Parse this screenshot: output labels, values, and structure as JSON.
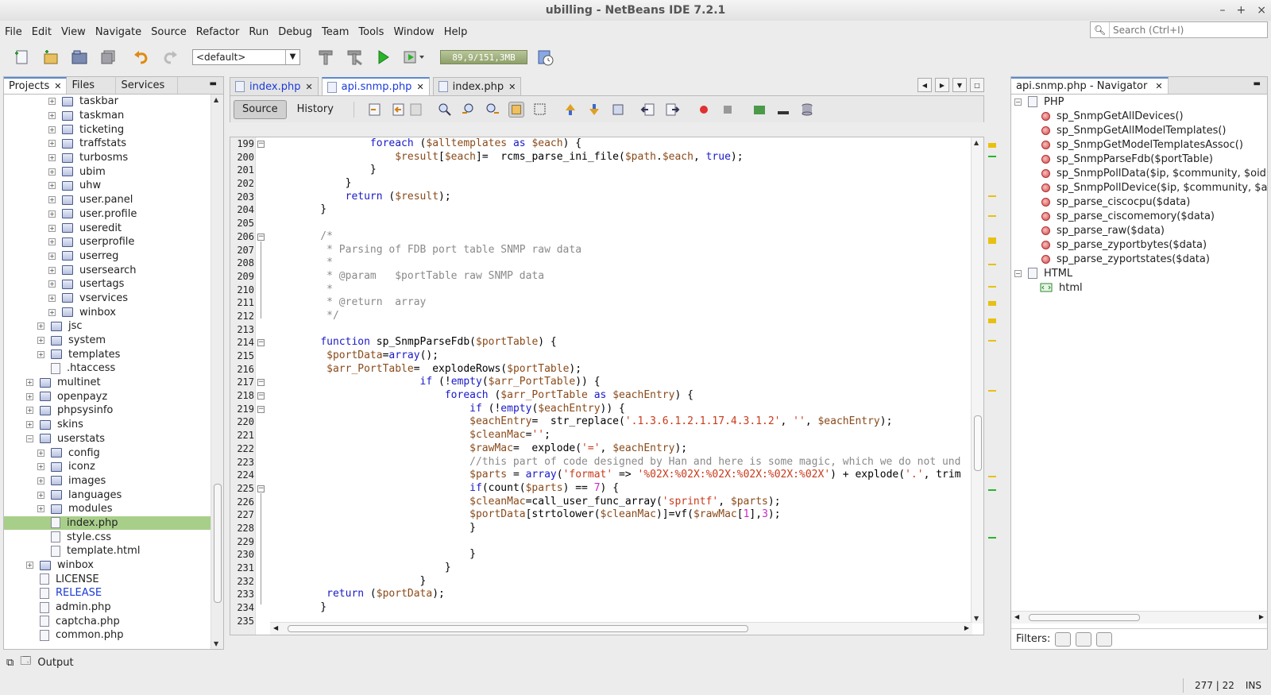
{
  "window": {
    "title": "ubilling - NetBeans IDE 7.2.1",
    "controls": [
      "–",
      "+",
      "×"
    ]
  },
  "menu": [
    "File",
    "Edit",
    "View",
    "Navigate",
    "Source",
    "Refactor",
    "Run",
    "Debug",
    "Team",
    "Tools",
    "Window",
    "Help"
  ],
  "search": {
    "placeholder": "Search (Ctrl+I)"
  },
  "toolbar": {
    "config": "<default>",
    "memory": "89,9/151,3MB"
  },
  "projects_panel": {
    "tabs": [
      {
        "label": "Projects",
        "active": true
      },
      {
        "label": "Files"
      },
      {
        "label": "Services"
      }
    ],
    "tree": [
      {
        "label": "taskbar",
        "indent": 3,
        "exp": "+",
        "icon": "folder"
      },
      {
        "label": "taskman",
        "indent": 3,
        "exp": "+",
        "icon": "folder"
      },
      {
        "label": "ticketing",
        "indent": 3,
        "exp": "+",
        "icon": "folder"
      },
      {
        "label": "traffstats",
        "indent": 3,
        "exp": "+",
        "icon": "folder"
      },
      {
        "label": "turbosms",
        "indent": 3,
        "exp": "+",
        "icon": "folder"
      },
      {
        "label": "ubim",
        "indent": 3,
        "exp": "+",
        "icon": "folder"
      },
      {
        "label": "uhw",
        "indent": 3,
        "exp": "+",
        "icon": "folder"
      },
      {
        "label": "user.panel",
        "indent": 3,
        "exp": "+",
        "icon": "folder"
      },
      {
        "label": "user.profile",
        "indent": 3,
        "exp": "+",
        "icon": "folder"
      },
      {
        "label": "useredit",
        "indent": 3,
        "exp": "+",
        "icon": "folder"
      },
      {
        "label": "userprofile",
        "indent": 3,
        "exp": "+",
        "icon": "folder"
      },
      {
        "label": "userreg",
        "indent": 3,
        "exp": "+",
        "icon": "folder"
      },
      {
        "label": "usersearch",
        "indent": 3,
        "exp": "+",
        "icon": "folder"
      },
      {
        "label": "usertags",
        "indent": 3,
        "exp": "+",
        "icon": "folder"
      },
      {
        "label": "vservices",
        "indent": 3,
        "exp": "+",
        "icon": "folder"
      },
      {
        "label": "winbox",
        "indent": 3,
        "exp": "+",
        "icon": "folder"
      },
      {
        "label": "jsc",
        "indent": 2,
        "exp": "+",
        "icon": "folder"
      },
      {
        "label": "system",
        "indent": 2,
        "exp": "+",
        "icon": "folder"
      },
      {
        "label": "templates",
        "indent": 2,
        "exp": "+",
        "icon": "folder"
      },
      {
        "label": ".htaccess",
        "indent": 2,
        "exp": "",
        "icon": "file"
      },
      {
        "label": "multinet",
        "indent": 1,
        "exp": "+",
        "icon": "folder"
      },
      {
        "label": "openpayz",
        "indent": 1,
        "exp": "+",
        "icon": "folder"
      },
      {
        "label": "phpsysinfo",
        "indent": 1,
        "exp": "+",
        "icon": "folder"
      },
      {
        "label": "skins",
        "indent": 1,
        "exp": "+",
        "icon": "folder"
      },
      {
        "label": "userstats",
        "indent": 1,
        "exp": "−",
        "icon": "folder"
      },
      {
        "label": "config",
        "indent": 2,
        "exp": "+",
        "icon": "folder"
      },
      {
        "label": "iconz",
        "indent": 2,
        "exp": "+",
        "icon": "folder"
      },
      {
        "label": "images",
        "indent": 2,
        "exp": "+",
        "icon": "folder"
      },
      {
        "label": "languages",
        "indent": 2,
        "exp": "+",
        "icon": "folder"
      },
      {
        "label": "modules",
        "indent": 2,
        "exp": "+",
        "icon": "folder"
      },
      {
        "label": "index.php",
        "indent": 2,
        "exp": "",
        "icon": "file",
        "selected": true
      },
      {
        "label": "style.css",
        "indent": 2,
        "exp": "",
        "icon": "file"
      },
      {
        "label": "template.html",
        "indent": 2,
        "exp": "",
        "icon": "file"
      },
      {
        "label": "winbox",
        "indent": 1,
        "exp": "+",
        "icon": "folder"
      },
      {
        "label": "LICENSE",
        "indent": 1,
        "exp": "",
        "icon": "file"
      },
      {
        "label": "RELEASE",
        "indent": 1,
        "exp": "",
        "icon": "file",
        "blue": true
      },
      {
        "label": "admin.php",
        "indent": 1,
        "exp": "",
        "icon": "file"
      },
      {
        "label": "captcha.php",
        "indent": 1,
        "exp": "",
        "icon": "file"
      },
      {
        "label": "common.php",
        "indent": 1,
        "exp": "",
        "icon": "file"
      }
    ]
  },
  "editor": {
    "tabs": [
      {
        "label": "index.php"
      },
      {
        "label": "api.snmp.php",
        "active": true
      },
      {
        "label": "index.php"
      }
    ],
    "source_label": "Source",
    "history_label": "History",
    "lines": [
      {
        "n": "199",
        "t": [
          [
            "            ",
            ""
          ],
          [
            "foreach",
            "kw"
          ],
          [
            " (",
            ""
          ],
          [
            "$alltemplates",
            "var"
          ],
          [
            " ",
            ""
          ],
          [
            "as",
            "kw"
          ],
          [
            " ",
            ""
          ],
          [
            "$each",
            "var"
          ],
          [
            ") {",
            ""
          ]
        ]
      },
      {
        "n": "200",
        "t": [
          [
            "                ",
            ""
          ],
          [
            "$result",
            "var"
          ],
          [
            "[",
            ""
          ],
          [
            "$each",
            "var"
          ],
          [
            "]=  rcms_parse_ini_file(",
            ""
          ],
          [
            "$path",
            "var"
          ],
          [
            ".",
            ""
          ],
          [
            "$each",
            "var"
          ],
          [
            ", ",
            ""
          ],
          [
            "true",
            "kw"
          ],
          [
            ");",
            ""
          ]
        ]
      },
      {
        "n": "201",
        "t": [
          [
            "            }",
            ""
          ]
        ]
      },
      {
        "n": "202",
        "t": [
          [
            "        }",
            ""
          ]
        ]
      },
      {
        "n": "203",
        "t": [
          [
            "        ",
            ""
          ],
          [
            "return",
            "kw"
          ],
          [
            " (",
            ""
          ],
          [
            "$result",
            "var"
          ],
          [
            ");",
            ""
          ]
        ]
      },
      {
        "n": "204",
        "t": [
          [
            "    }",
            ""
          ]
        ]
      },
      {
        "n": "205",
        "t": [
          [
            "",
            ""
          ]
        ]
      },
      {
        "n": "206",
        "t": [
          [
            "    /*",
            "cmt"
          ]
        ]
      },
      {
        "n": "207",
        "t": [
          [
            "     * Parsing of FDB port table SNMP raw data",
            "cmt"
          ]
        ]
      },
      {
        "n": "208",
        "t": [
          [
            "     *",
            "cmt"
          ]
        ]
      },
      {
        "n": "209",
        "t": [
          [
            "     * @param   $portTable raw SNMP data",
            "cmt"
          ]
        ]
      },
      {
        "n": "210",
        "t": [
          [
            "     *",
            "cmt"
          ]
        ]
      },
      {
        "n": "211",
        "t": [
          [
            "     * @return  array",
            "cmt"
          ]
        ]
      },
      {
        "n": "212",
        "t": [
          [
            "     */",
            "cmt"
          ]
        ]
      },
      {
        "n": "213",
        "t": [
          [
            "",
            ""
          ]
        ]
      },
      {
        "n": "214",
        "t": [
          [
            "    ",
            ""
          ],
          [
            "function",
            "kw"
          ],
          [
            " sp_SnmpParseFdb(",
            ""
          ],
          [
            "$portTable",
            "var"
          ],
          [
            ") {",
            ""
          ]
        ]
      },
      {
        "n": "215",
        "t": [
          [
            "     ",
            ""
          ],
          [
            "$portData",
            "var"
          ],
          [
            "=",
            ""
          ],
          [
            "array",
            "kw"
          ],
          [
            "();",
            ""
          ]
        ]
      },
      {
        "n": "216",
        "t": [
          [
            "     ",
            ""
          ],
          [
            "$arr_PortTable",
            "var"
          ],
          [
            "=  explodeRows(",
            ""
          ],
          [
            "$portTable",
            "var"
          ],
          [
            ");",
            ""
          ]
        ]
      },
      {
        "n": "217",
        "t": [
          [
            "                    ",
            ""
          ],
          [
            "if",
            "kw"
          ],
          [
            " (!",
            ""
          ],
          [
            "empty",
            "kw"
          ],
          [
            "(",
            ""
          ],
          [
            "$arr_PortTable",
            "var"
          ],
          [
            ")) {",
            ""
          ]
        ]
      },
      {
        "n": "218",
        "t": [
          [
            "                        ",
            ""
          ],
          [
            "foreach",
            "kw"
          ],
          [
            " (",
            ""
          ],
          [
            "$arr_PortTable",
            "var"
          ],
          [
            " ",
            ""
          ],
          [
            "as",
            "kw"
          ],
          [
            " ",
            ""
          ],
          [
            "$eachEntry",
            "var"
          ],
          [
            ") {",
            ""
          ]
        ]
      },
      {
        "n": "219",
        "t": [
          [
            "                            ",
            ""
          ],
          [
            "if",
            "kw"
          ],
          [
            " (!",
            ""
          ],
          [
            "empty",
            "kw"
          ],
          [
            "(",
            ""
          ],
          [
            "$eachEntry",
            "var"
          ],
          [
            ")) {",
            ""
          ]
        ]
      },
      {
        "n": "220",
        "t": [
          [
            "                            ",
            ""
          ],
          [
            "$eachEntry",
            "var"
          ],
          [
            "=  str_replace(",
            ""
          ],
          [
            "'.1.3.6.1.2.1.17.4.3.1.2'",
            "str"
          ],
          [
            ", ",
            ""
          ],
          [
            "''",
            "str"
          ],
          [
            ", ",
            ""
          ],
          [
            "$eachEntry",
            "var"
          ],
          [
            ");",
            ""
          ]
        ]
      },
      {
        "n": "221",
        "t": [
          [
            "                            ",
            ""
          ],
          [
            "$cleanMac",
            "var"
          ],
          [
            "=",
            ""
          ],
          [
            "''",
            "str"
          ],
          [
            ";",
            ""
          ]
        ]
      },
      {
        "n": "222",
        "t": [
          [
            "                            ",
            ""
          ],
          [
            "$rawMac",
            "var"
          ],
          [
            "=  explode(",
            ""
          ],
          [
            "'='",
            "str"
          ],
          [
            ", ",
            ""
          ],
          [
            "$eachEntry",
            "var"
          ],
          [
            ");",
            ""
          ]
        ]
      },
      {
        "n": "223",
        "t": [
          [
            "                            //this part of code designed by Han and here is some magic, which we do not und",
            "cmt"
          ]
        ]
      },
      {
        "n": "224",
        "t": [
          [
            "                            ",
            ""
          ],
          [
            "$parts",
            "var"
          ],
          [
            " = ",
            ""
          ],
          [
            "array",
            "kw"
          ],
          [
            "(",
            ""
          ],
          [
            "'format'",
            "str"
          ],
          [
            " => ",
            ""
          ],
          [
            "'%02X:%02X:%02X:%02X:%02X:%02X'",
            "str"
          ],
          [
            ") + explode(",
            ""
          ],
          [
            "'.'",
            "str"
          ],
          [
            ", trim",
            ""
          ]
        ]
      },
      {
        "n": "225",
        "t": [
          [
            "                            ",
            ""
          ],
          [
            "if",
            "kw"
          ],
          [
            "(count(",
            ""
          ],
          [
            "$parts",
            "var"
          ],
          [
            ") == ",
            ""
          ],
          [
            "7",
            "num"
          ],
          [
            ") {",
            ""
          ]
        ]
      },
      {
        "n": "226",
        "t": [
          [
            "                            ",
            ""
          ],
          [
            "$cleanMac",
            "var"
          ],
          [
            "=call_user_func_array(",
            ""
          ],
          [
            "'sprintf'",
            "str"
          ],
          [
            ", ",
            ""
          ],
          [
            "$parts",
            "var"
          ],
          [
            ");",
            ""
          ]
        ]
      },
      {
        "n": "227",
        "t": [
          [
            "                            ",
            ""
          ],
          [
            "$portData",
            "var"
          ],
          [
            "[strtolower(",
            ""
          ],
          [
            "$cleanMac",
            "var"
          ],
          [
            ")]=vf(",
            ""
          ],
          [
            "$rawMac",
            "var"
          ],
          [
            "[",
            ""
          ],
          [
            "1",
            "num"
          ],
          [
            "],",
            ""
          ],
          [
            "3",
            "num"
          ],
          [
            ");",
            ""
          ]
        ]
      },
      {
        "n": "228",
        "t": [
          [
            "                            }",
            ""
          ]
        ]
      },
      {
        "n": "229",
        "t": [
          [
            "",
            ""
          ]
        ]
      },
      {
        "n": "230",
        "t": [
          [
            "                            }",
            ""
          ]
        ]
      },
      {
        "n": "231",
        "t": [
          [
            "                        }",
            ""
          ]
        ]
      },
      {
        "n": "232",
        "t": [
          [
            "                    }",
            ""
          ]
        ]
      },
      {
        "n": "233",
        "t": [
          [
            "     ",
            ""
          ],
          [
            "return",
            "kw"
          ],
          [
            " (",
            ""
          ],
          [
            "$portData",
            "var"
          ],
          [
            ");",
            ""
          ]
        ]
      },
      {
        "n": "234",
        "t": [
          [
            "    }",
            ""
          ]
        ]
      },
      {
        "n": "235",
        "t": [
          [
            "",
            ""
          ]
        ]
      }
    ]
  },
  "navigator": {
    "tab": "api.snmp.php - Navigator",
    "php_label": "PHP",
    "functions": [
      "sp_SnmpGetAllDevices()",
      "sp_SnmpGetAllModelTemplates()",
      "sp_SnmpGetModelTemplatesAssoc()",
      "sp_SnmpParseFdb($portTable)",
      "sp_SnmpPollData($ip, $community, $oid, $c",
      "sp_SnmpPollDevice($ip, $community, $allte",
      "sp_parse_ciscocpu($data)",
      "sp_parse_ciscomemory($data)",
      "sp_parse_raw($data)",
      "sp_parse_zyportbytes($data)",
      "sp_parse_zyportstates($data)"
    ],
    "html_label": "HTML",
    "html_child": "html",
    "filters_label": "Filters:"
  },
  "output_label": "Output",
  "status": {
    "position": "277 | 22",
    "mode": "INS"
  },
  "colors": {
    "accent": "#5a8ad0",
    "selection": "#a8cf8a",
    "keyword": "#1a1ac8",
    "variable": "#8a4a1a",
    "string": "#c83a1a",
    "comment": "#8a8a8a"
  }
}
